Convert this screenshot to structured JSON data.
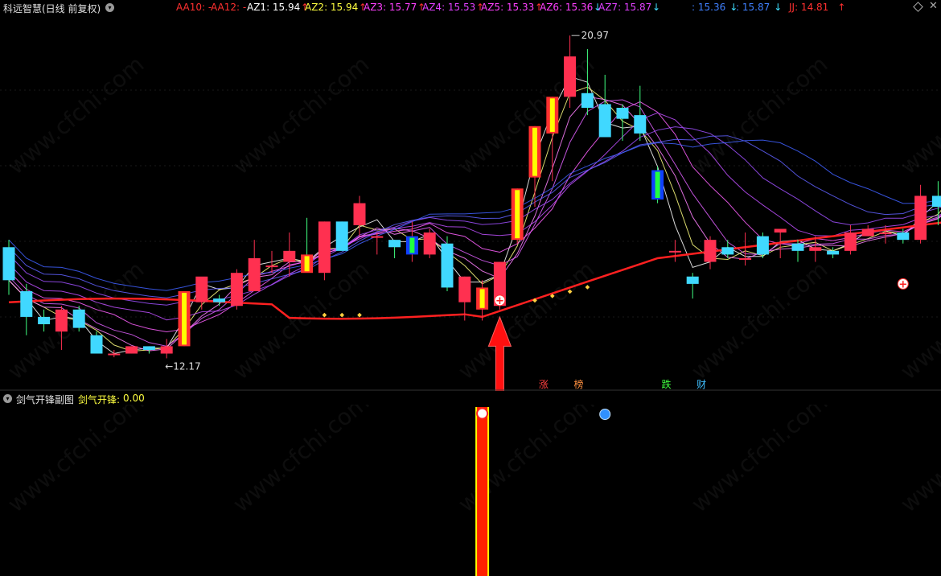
{
  "header": {
    "title": "科远智慧(日线 前复权)",
    "indicators": [
      {
        "label": "AA10: -",
        "color": "#ff3030"
      },
      {
        "label": "AA12: -",
        "color": "#ff3030"
      },
      {
        "label": "AZ1: 15.94",
        "arrow": "↑",
        "color": "#ffffff",
        "arrow_color": "#ff3030"
      },
      {
        "label": "AZ2: 15.94",
        "arrow": "↑",
        "color": "#ffff40",
        "arrow_color": "#ff3030"
      },
      {
        "label": "AZ3: 15.77",
        "arrow": "↑",
        "color": "#ff40ff",
        "arrow_color": "#ff3030"
      },
      {
        "label": "AZ4: 15.53",
        "arrow": "↑",
        "color": "#e040ff",
        "arrow_color": "#ff3030"
      },
      {
        "label": "AZ5: 15.33",
        "arrow": "↑",
        "color": "#ff40ff",
        "arrow_color": "#ff3030"
      },
      {
        "label": "AZ6: 15.36",
        "arrow": "↓",
        "color": "#ff40ff",
        "arrow_color": "#40e0ff"
      },
      {
        "label": "AZ7: 15.87",
        "arrow": "↓",
        "color": "#e040ff",
        "arrow_color": "#40e0ff"
      },
      {
        "label": ": 15.36",
        "arrow": "↓",
        "color": "#4080ff",
        "arrow_color": "#40e0ff"
      },
      {
        "label": ": 15.87",
        "arrow": "↓",
        "color": "#4080ff",
        "arrow_color": "#40e0ff"
      },
      {
        "label": "JJ: 14.81",
        "arrow": "↑",
        "color": "#ff3030",
        "arrow_color": "#ff3030"
      }
    ]
  },
  "annotations": {
    "high_label": "20.97",
    "low_label": "12.17",
    "zhang": "涨",
    "bang": "榜",
    "die": "跌",
    "cai": "财"
  },
  "sub_panel": {
    "title": "剑气开锋副图",
    "indicator_label": "剑气开锋:",
    "indicator_value": "0.00"
  },
  "watermark": "www.cfchi.com",
  "colors": {
    "up": "#ff3050",
    "down": "#40d8ff",
    "trend_line": "#ff2020",
    "signal_bar": "#ff2000",
    "signal_edge": "#ffff00"
  },
  "chart_data": {
    "type": "candlestick",
    "price_range": [
      11.5,
      21.5
    ],
    "candles": [
      {
        "o": 15.2,
        "h": 15.4,
        "l": 13.9,
        "c": 14.3
      },
      {
        "o": 14.0,
        "h": 14.2,
        "l": 12.8,
        "c": 13.3
      },
      {
        "o": 13.3,
        "h": 13.5,
        "l": 12.9,
        "c": 13.1
      },
      {
        "o": 12.9,
        "h": 13.6,
        "l": 12.4,
        "c": 13.5
      },
      {
        "o": 13.5,
        "h": 13.6,
        "l": 12.9,
        "c": 13.0
      },
      {
        "o": 12.8,
        "h": 12.9,
        "l": 12.3,
        "c": 12.3
      },
      {
        "o": 12.3,
        "h": 12.4,
        "l": 12.2,
        "c": 12.3
      },
      {
        "o": 12.3,
        "h": 12.5,
        "l": 12.3,
        "c": 12.5
      },
      {
        "o": 12.5,
        "h": 12.5,
        "l": 12.3,
        "c": 12.4
      },
      {
        "o": 12.3,
        "h": 12.7,
        "l": 12.17,
        "c": 12.5
      },
      {
        "o": 12.5,
        "h": 14.0,
        "l": 12.5,
        "c": 14.0
      },
      {
        "o": 13.7,
        "h": 14.3,
        "l": 13.5,
        "c": 14.4
      },
      {
        "o": 13.8,
        "h": 13.9,
        "l": 13.6,
        "c": 13.7
      },
      {
        "o": 13.6,
        "h": 14.6,
        "l": 13.5,
        "c": 14.5
      },
      {
        "o": 14.0,
        "h": 15.4,
        "l": 14.0,
        "c": 14.9
      },
      {
        "o": 14.7,
        "h": 15.1,
        "l": 14.5,
        "c": 14.7
      },
      {
        "o": 14.8,
        "h": 15.6,
        "l": 14.4,
        "c": 15.1
      },
      {
        "o": 15.0,
        "h": 16.0,
        "l": 14.8,
        "c": 14.5
      },
      {
        "o": 14.5,
        "h": 15.9,
        "l": 14.3,
        "c": 15.9
      },
      {
        "o": 15.9,
        "h": 15.9,
        "l": 15.1,
        "c": 15.1
      },
      {
        "o": 15.8,
        "h": 16.6,
        "l": 15.5,
        "c": 16.4
      },
      {
        "o": 15.5,
        "h": 15.6,
        "l": 15.0,
        "c": 15.5
      },
      {
        "o": 15.4,
        "h": 15.4,
        "l": 14.9,
        "c": 15.2
      },
      {
        "o": 15.0,
        "h": 15.9,
        "l": 14.8,
        "c": 15.5
      },
      {
        "o": 15.0,
        "h": 15.7,
        "l": 14.9,
        "c": 15.6
      },
      {
        "o": 15.3,
        "h": 15.5,
        "l": 14.0,
        "c": 14.1
      },
      {
        "o": 13.7,
        "h": 14.4,
        "l": 13.2,
        "c": 14.4
      },
      {
        "o": 13.5,
        "h": 14.3,
        "l": 13.2,
        "c": 14.1
      },
      {
        "o": 13.6,
        "h": 14.8,
        "l": 13.5,
        "c": 14.8
      },
      {
        "o": 15.4,
        "h": 16.8,
        "l": 15.3,
        "c": 16.8
      },
      {
        "o": 17.1,
        "h": 18.5,
        "l": 16.3,
        "c": 18.5
      },
      {
        "o": 18.3,
        "h": 19.3,
        "l": 17.0,
        "c": 19.3
      },
      {
        "o": 19.3,
        "h": 20.97,
        "l": 19.0,
        "c": 20.4
      },
      {
        "o": 19.4,
        "h": 20.6,
        "l": 18.8,
        "c": 19.0
      },
      {
        "o": 19.1,
        "h": 19.9,
        "l": 18.2,
        "c": 18.2
      },
      {
        "o": 19.0,
        "h": 19.1,
        "l": 18.1,
        "c": 18.7
      },
      {
        "o": 18.8,
        "h": 19.6,
        "l": 18.1,
        "c": 18.3
      },
      {
        "o": 17.3,
        "h": 17.4,
        "l": 16.4,
        "c": 16.5
      },
      {
        "o": 15.1,
        "h": 15.4,
        "l": 14.8,
        "c": 15.1
      },
      {
        "o": 14.4,
        "h": 14.5,
        "l": 13.8,
        "c": 14.2
      },
      {
        "o": 14.8,
        "h": 15.5,
        "l": 14.6,
        "c": 15.4
      },
      {
        "o": 15.2,
        "h": 15.4,
        "l": 14.9,
        "c": 15.0
      },
      {
        "o": 14.9,
        "h": 15.6,
        "l": 14.7,
        "c": 14.9
      },
      {
        "o": 15.5,
        "h": 15.6,
        "l": 14.9,
        "c": 15.0
      },
      {
        "o": 15.6,
        "h": 15.7,
        "l": 14.9,
        "c": 15.7
      },
      {
        "o": 15.3,
        "h": 15.4,
        "l": 14.8,
        "c": 15.1
      },
      {
        "o": 15.1,
        "h": 15.5,
        "l": 14.8,
        "c": 15.2
      },
      {
        "o": 15.1,
        "h": 15.2,
        "l": 14.9,
        "c": 15.0
      },
      {
        "o": 15.1,
        "h": 15.8,
        "l": 15.0,
        "c": 15.6
      },
      {
        "o": 15.5,
        "h": 15.8,
        "l": 15.5,
        "c": 15.7
      },
      {
        "o": 15.6,
        "h": 15.8,
        "l": 15.3,
        "c": 15.6
      },
      {
        "o": 15.6,
        "h": 15.7,
        "l": 15.3,
        "c": 15.4
      },
      {
        "o": 15.4,
        "h": 16.9,
        "l": 15.3,
        "c": 16.6
      },
      {
        "o": 16.6,
        "h": 17.0,
        "l": 15.8,
        "c": 16.3
      },
      {
        "o": 16.3,
        "h": 17.5,
        "l": 16.0,
        "c": 17.2
      }
    ],
    "highlight_yellow": [
      10,
      17,
      27,
      29,
      30,
      31
    ],
    "highlight_green": [
      23,
      37
    ],
    "sub_signal_index": 27,
    "sub_value": 0.0
  }
}
